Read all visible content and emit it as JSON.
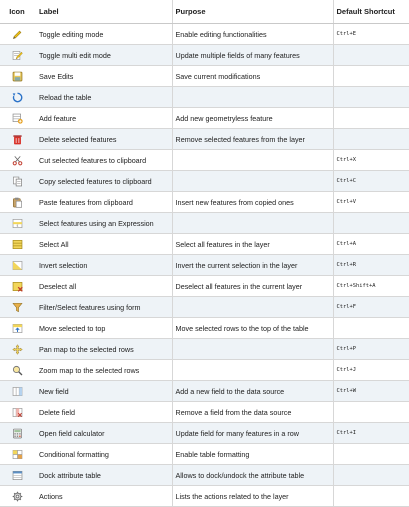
{
  "header": {
    "icon": "Icon",
    "label": "Label",
    "purpose": "Purpose",
    "shortcut": "Default Shortcut"
  },
  "rows": [
    {
      "icon": "pencil-icon",
      "label": "Toggle editing mode",
      "purpose": "Enable editing functionalities",
      "shortcut": "Ctrl+E"
    },
    {
      "icon": "multi-edit-icon",
      "label": "Toggle multi edit mode",
      "purpose": "Update multiple fields of many features",
      "shortcut": ""
    },
    {
      "icon": "save-edits-icon",
      "label": "Save Edits",
      "purpose": "Save current modifications",
      "shortcut": ""
    },
    {
      "icon": "reload-icon",
      "label": "Reload the table",
      "purpose": "",
      "shortcut": ""
    },
    {
      "icon": "add-feature-icon",
      "label": "Add feature",
      "purpose": "Add new geometryless feature",
      "shortcut": ""
    },
    {
      "icon": "delete-features-icon",
      "label": "Delete selected features",
      "purpose": "Remove selected features from the layer",
      "shortcut": ""
    },
    {
      "icon": "cut-icon",
      "label": "Cut selected features to clipboard",
      "purpose": "",
      "shortcut": "Ctrl+X"
    },
    {
      "icon": "copy-icon",
      "label": "Copy selected features to clipboard",
      "purpose": "",
      "shortcut": "Ctrl+C"
    },
    {
      "icon": "paste-icon",
      "label": "Paste features from clipboard",
      "purpose": "Insert new features from copied ones",
      "shortcut": "Ctrl+V"
    },
    {
      "icon": "expression-select-icon",
      "label": "Select features using an Expression",
      "purpose": "",
      "shortcut": ""
    },
    {
      "icon": "select-all-icon",
      "label": "Select All",
      "purpose": "Select all features in the layer",
      "shortcut": "Ctrl+A"
    },
    {
      "icon": "invert-selection-icon",
      "label": "Invert selection",
      "purpose": "Invert the current selection in the layer",
      "shortcut": "Ctrl+R"
    },
    {
      "icon": "deselect-all-icon",
      "label": "Deselect all",
      "purpose": "Deselect all features in the current layer",
      "shortcut": "Ctrl+Shift+A"
    },
    {
      "icon": "filter-form-icon",
      "label": "Filter/Select features using form",
      "purpose": "",
      "shortcut": "Ctrl+F"
    },
    {
      "icon": "move-to-top-icon",
      "label": "Move selected to top",
      "purpose": "Move selected rows to the top of the table",
      "shortcut": ""
    },
    {
      "icon": "pan-to-selected-icon",
      "label": "Pan map to the selected rows",
      "purpose": "",
      "shortcut": "Ctrl+P"
    },
    {
      "icon": "zoom-to-selected-icon",
      "label": "Zoom map to the selected rows",
      "purpose": "",
      "shortcut": "Ctrl+J"
    },
    {
      "icon": "new-field-icon",
      "label": "New field",
      "purpose": "Add a new field to the data source",
      "shortcut": "Ctrl+W"
    },
    {
      "icon": "delete-field-icon",
      "label": "Delete field",
      "purpose": "Remove a field from the data source",
      "shortcut": ""
    },
    {
      "icon": "field-calculator-icon",
      "label": "Open field calculator",
      "purpose": "Update field for many features in a row",
      "shortcut": "Ctrl+I"
    },
    {
      "icon": "conditional-formatting-icon",
      "label": "Conditional formatting",
      "purpose": "Enable table formatting",
      "shortcut": ""
    },
    {
      "icon": "dock-table-icon",
      "label": "Dock attribute table",
      "purpose": "Allows to dock/undock the attribute table",
      "shortcut": ""
    },
    {
      "icon": "actions-icon",
      "label": "Actions",
      "purpose": "Lists the actions related to the layer",
      "shortcut": ""
    }
  ]
}
